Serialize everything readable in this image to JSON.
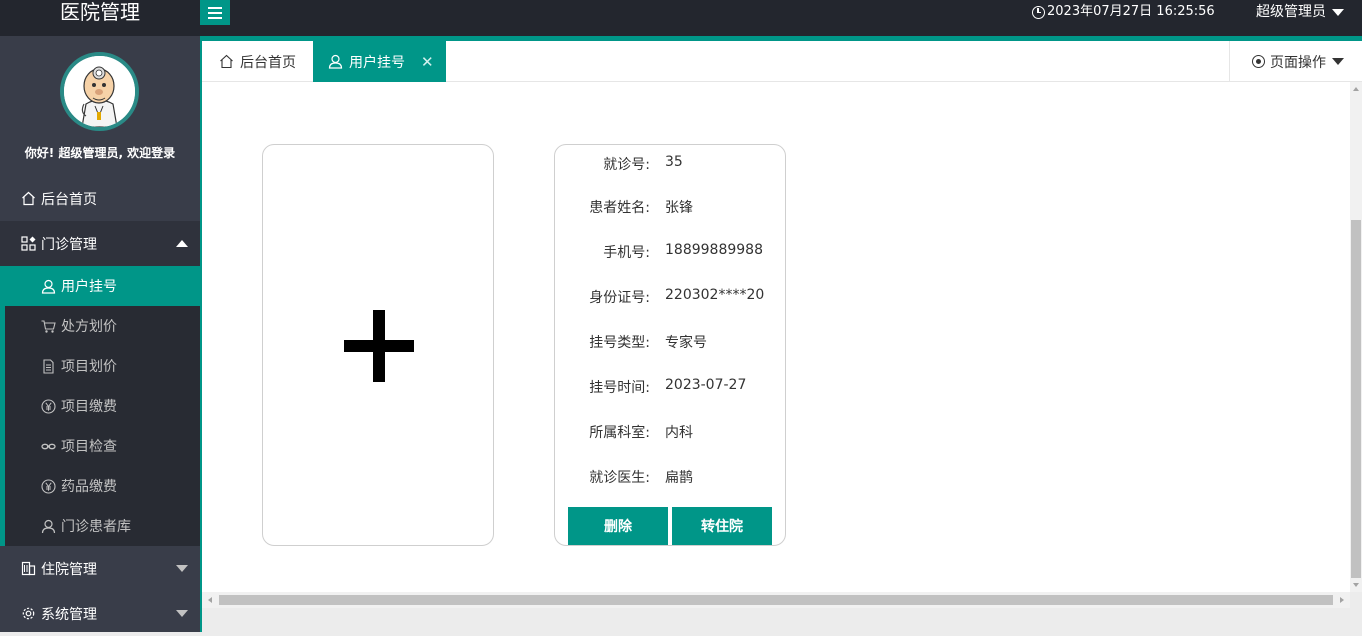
{
  "header": {
    "app_title": "医院管理",
    "datetime": "2023年07月27日 16:25:56",
    "user_menu": "超级管理员"
  },
  "sidebar": {
    "greeting": "你好! 超级管理员, 欢迎登录",
    "items": [
      {
        "label": "后台首页",
        "icon": "home-icon"
      },
      {
        "label": "门诊管理",
        "icon": "apps-icon",
        "expanded": true
      },
      {
        "label": "住院管理",
        "icon": "building-icon"
      },
      {
        "label": "系统管理",
        "icon": "gear-icon"
      }
    ],
    "subitems": [
      {
        "label": "用户挂号",
        "icon": "user-icon",
        "active": true
      },
      {
        "label": "处方划价",
        "icon": "cart-icon"
      },
      {
        "label": "项目划价",
        "icon": "document-icon"
      },
      {
        "label": "项目缴费",
        "icon": "yen-icon"
      },
      {
        "label": "项目检查",
        "icon": "link-icon"
      },
      {
        "label": "药品缴费",
        "icon": "yen-icon"
      },
      {
        "label": "门诊患者库",
        "icon": "user-icon"
      }
    ]
  },
  "tabs": [
    {
      "label": "后台首页",
      "icon": "home-icon"
    },
    {
      "label": "用户挂号",
      "icon": "user-icon",
      "active": true
    }
  ],
  "page_ops": "页面操作",
  "record": {
    "fields": [
      {
        "label": "就诊号:",
        "value": "35"
      },
      {
        "label": "患者姓名:",
        "value": "张锋"
      },
      {
        "label": "手机号:",
        "value": "18899889988"
      },
      {
        "label": "身份证号:",
        "value": "220302****20"
      },
      {
        "label": "挂号类型:",
        "value": "专家号"
      },
      {
        "label": "挂号时间:",
        "value": "2023-07-27"
      },
      {
        "label": "所属科室:",
        "value": "内科"
      },
      {
        "label": "就诊医生:",
        "value": "扁鹊"
      }
    ],
    "delete_label": "删除",
    "transfer_label": "转住院"
  },
  "colors": {
    "accent": "#009688",
    "header_bg": "#23262e",
    "sidebar_bg": "#393d49",
    "subnav_bg": "#282b33"
  }
}
